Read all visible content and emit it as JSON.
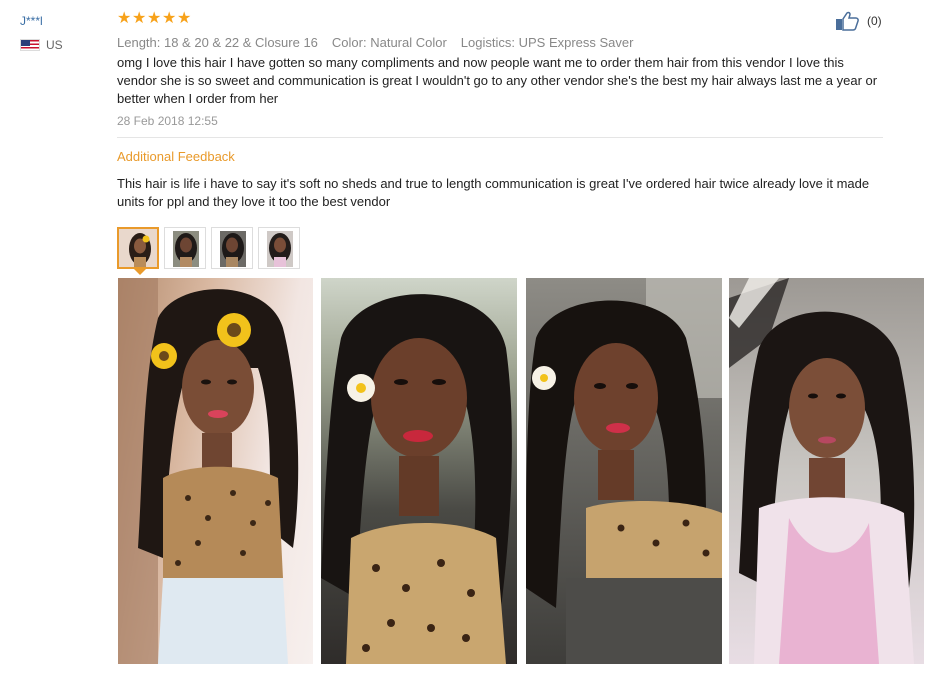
{
  "user": {
    "name": "J***l",
    "country": "US"
  },
  "review": {
    "rating": 5,
    "star_glyph": "★",
    "attributes": [
      "Length: 18 & 20 & 22 & Closure 16",
      "Color: Natural Color",
      "Logistics: UPS Express Saver"
    ],
    "text": "omg I love this hair I have gotten so many compliments and now people want me to order them hair from this vendor I love this vendor she is so sweet and communication is great I wouldn't go to any other vendor she's the best my hair always last me a year or better when I order from her",
    "date": "28 Feb 2018 12:55"
  },
  "like": {
    "icon": "thumbs-up-icon",
    "count": "(0)"
  },
  "additional_feedback": {
    "title": "Additional Feedback",
    "text": "This hair is life i have to say it's soft no sheds and true to length communication is great I've ordered hair twice already love it made units for ppl and they love it too the best vendor"
  },
  "photos": {
    "count": 4,
    "selected": 1
  },
  "colors": {
    "star": "#f7a21b",
    "accent": "#e99a2b",
    "username": "#3a6ea5"
  }
}
